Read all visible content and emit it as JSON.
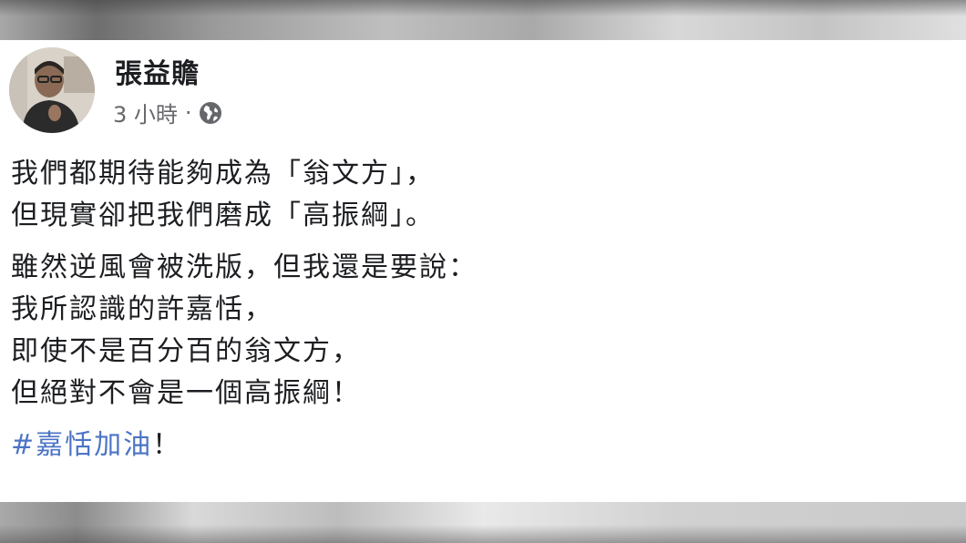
{
  "post": {
    "author": "張益贍",
    "time": "3 小時",
    "separator": "·",
    "privacy_icon": "globe-icon",
    "paragraph1": [
      "我們都期待能夠成為「翁文方」，",
      "但現實卻把我們磨成「高振綱」。"
    ],
    "paragraph2": [
      "雖然逆風會被洗版，但我還是要說：",
      "我所認識的許嘉恬，",
      "即使不是百分百的翁文方，",
      "但絕對不會是一個高振綱！"
    ],
    "hashtag": "#嘉恬加油",
    "hashtag_suffix": "！",
    "colors": {
      "hashtag": "#4c74c4",
      "text": "#1c1e21",
      "meta": "#65676b"
    }
  }
}
